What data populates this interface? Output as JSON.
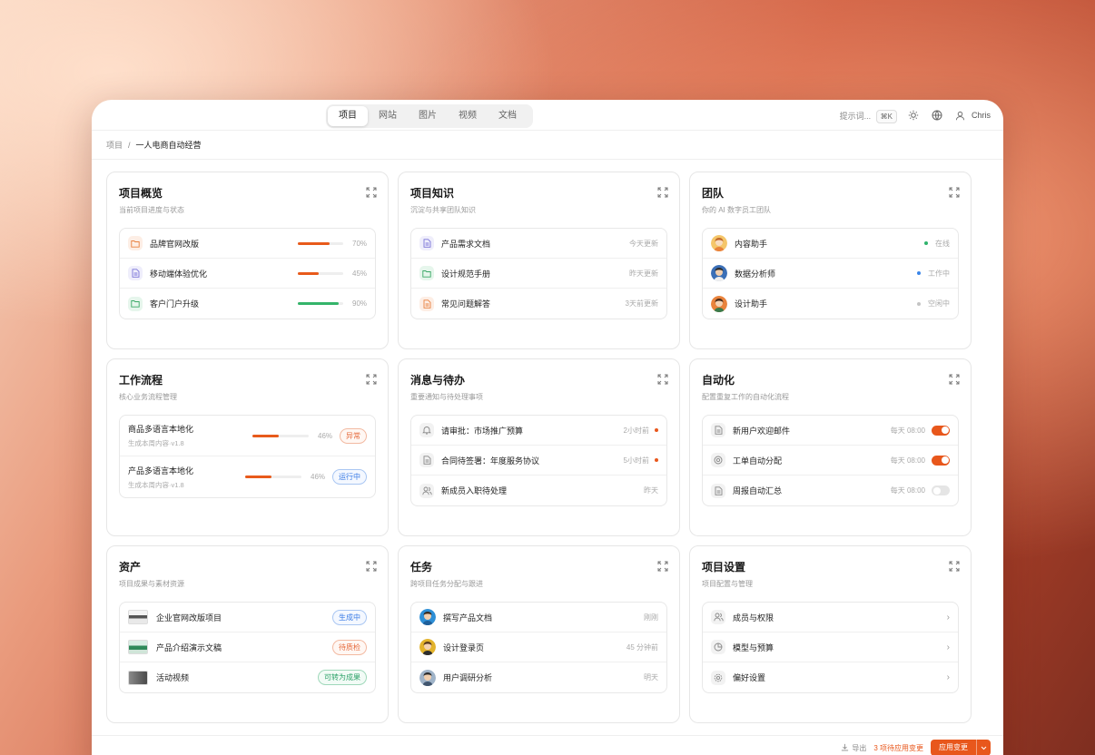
{
  "topbar": {
    "tabs": [
      "项目",
      "网站",
      "图片",
      "视频",
      "文档"
    ],
    "search_hint": "提示词...",
    "shortcut": "⌘K",
    "user_name": "Chris"
  },
  "breadcrumb": {
    "root": "项目",
    "separator": "/",
    "current": "一人电商自动经营"
  },
  "overview": {
    "title": "项目概览",
    "subtitle": "当前项目进度与状态",
    "items": [
      {
        "name": "品牌官网改版",
        "progress": 0.7,
        "pct": "70%",
        "color": "orange"
      },
      {
        "name": "移动端体验优化",
        "progress": 0.45,
        "pct": "45%",
        "color": "purple"
      },
      {
        "name": "客户门户升级",
        "progress": 0.9,
        "pct": "90%",
        "color": "green"
      }
    ]
  },
  "knowledge": {
    "title": "项目知识",
    "subtitle": "沉淀与共享团队知识",
    "items": [
      {
        "name": "产品需求文档",
        "meta": "今天更新",
        "color": "purple"
      },
      {
        "name": "设计规范手册",
        "meta": "昨天更新",
        "color": "green"
      },
      {
        "name": "常见问题解答",
        "meta": "3天前更新",
        "color": "orange"
      }
    ]
  },
  "team": {
    "title": "团队",
    "subtitle": "你的 AI 数字员工团队",
    "members": [
      {
        "name": "内容助手",
        "status": "在线",
        "status_color": "#2fb36c"
      },
      {
        "name": "数据分析师",
        "status": "工作中",
        "status_color": "#3a86e8"
      },
      {
        "name": "设计助手",
        "status": "空闲中",
        "status_color": "#c4c4c4"
      }
    ]
  },
  "workflow": {
    "title": "工作流程",
    "subtitle": "核心业务流程管理",
    "items": [
      {
        "name": "商品多语言本地化",
        "sub": "生成本周内容·v1.8",
        "progress": 0.46,
        "pct": "46%",
        "badge": "异常",
        "badge_type": "red"
      },
      {
        "name": "产品多语言本地化",
        "sub": "生成本周内容·v1.8",
        "progress": 0.46,
        "pct": "46%",
        "badge": "运行中",
        "badge_type": "blue"
      }
    ]
  },
  "messages": {
    "title": "消息与待办",
    "subtitle": "重要通知与待处理事项",
    "items": [
      {
        "icon": "bell-icon",
        "text": "请审批：市场推广预算",
        "time": "2小时前",
        "unread": true
      },
      {
        "icon": "document-icon",
        "text": "合同待签署：年度服务协议",
        "time": "5小时前",
        "unread": true
      },
      {
        "icon": "users-icon",
        "text": "新成员入职待处理",
        "time": "昨天",
        "unread": false
      }
    ]
  },
  "automation": {
    "title": "自动化",
    "subtitle": "配置重复工作的自动化流程",
    "items": [
      {
        "icon": "document-icon",
        "name": "新用户欢迎邮件",
        "schedule": "每天 08:00",
        "enabled": true
      },
      {
        "icon": "target-icon",
        "name": "工单自动分配",
        "schedule": "每天 08:00",
        "enabled": true
      },
      {
        "icon": "document-icon",
        "name": "周报自动汇总",
        "schedule": "每天 08:00",
        "enabled": false
      }
    ]
  },
  "assets": {
    "title": "资产",
    "subtitle": "项目成果与素材资源",
    "items": [
      {
        "name": "企业官网改版项目",
        "badge": "生成中",
        "badge_type": "blue"
      },
      {
        "name": "产品介绍演示文稿",
        "badge": "待质检",
        "badge_type": "red"
      },
      {
        "name": "活动视频",
        "badge": "可转为成果",
        "badge_type": "green"
      }
    ]
  },
  "tasks": {
    "title": "任务",
    "subtitle": "跨项目任务分配与跟进",
    "items": [
      {
        "name": "撰写产品文档",
        "time": "刚刚"
      },
      {
        "name": "设计登录页",
        "time": "45 分钟前"
      },
      {
        "name": "用户调研分析",
        "time": "明天"
      }
    ]
  },
  "settings": {
    "title": "项目设置",
    "subtitle": "项目配置与管理",
    "items": [
      {
        "icon": "users-icon",
        "name": "成员与权限"
      },
      {
        "icon": "pie-icon",
        "name": "模型与预算"
      },
      {
        "icon": "gear-icon",
        "name": "偏好设置"
      }
    ]
  },
  "footer": {
    "export_label": "导出",
    "pending_label": "3 项待应用变更",
    "apply_label": "应用变更"
  },
  "colors": {
    "accent": "#e8571c",
    "green": "#34b46a",
    "blue": "#3a7be5"
  }
}
